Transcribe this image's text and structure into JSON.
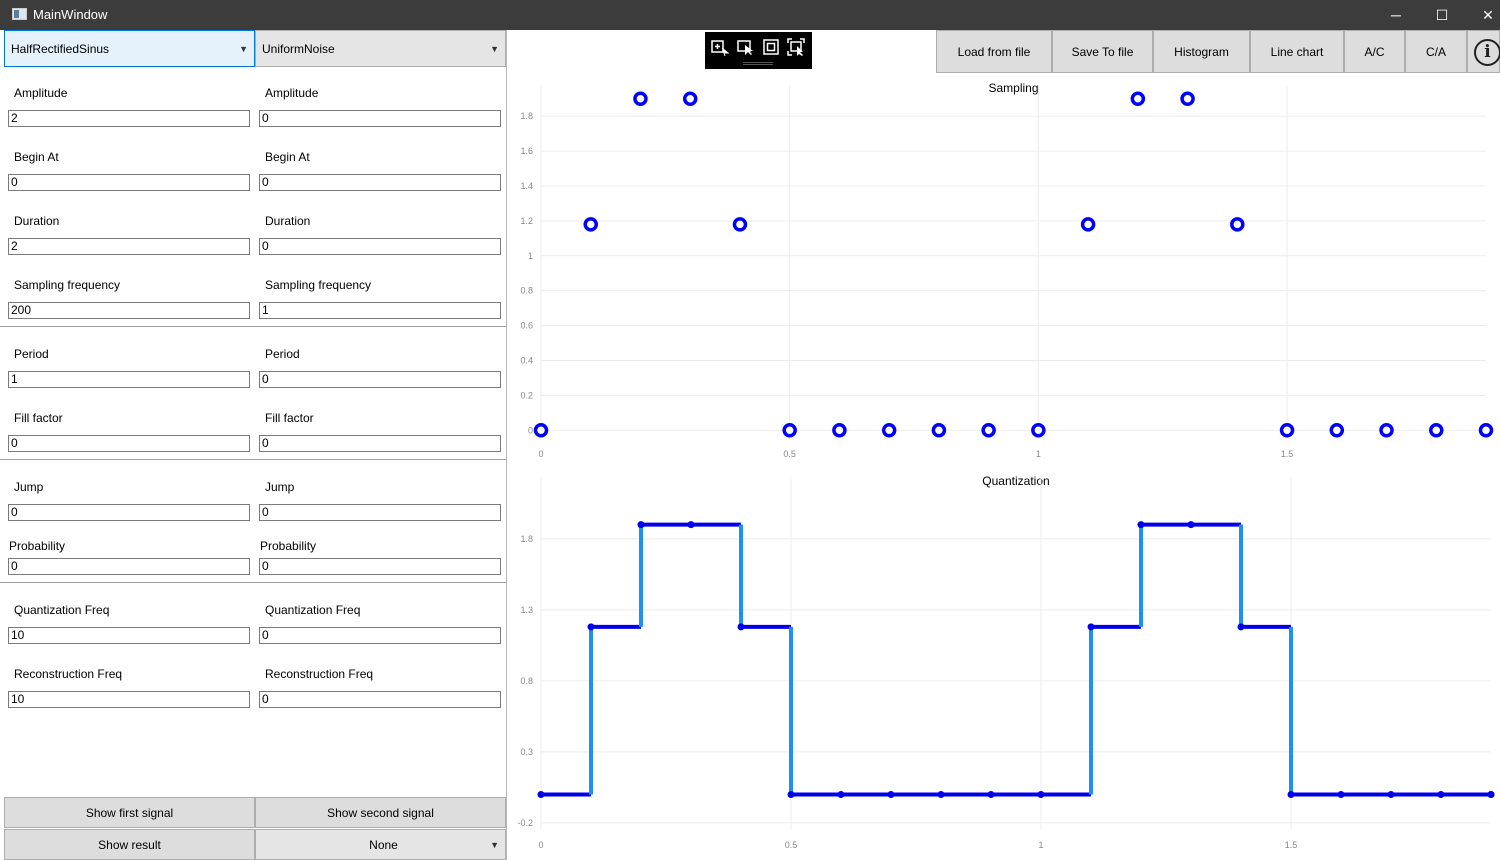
{
  "window": {
    "title": "MainWindow",
    "minimize": "─",
    "maximize": "☐",
    "close": "✕"
  },
  "combos": {
    "first_signal": "HalfRectifiedSinus",
    "second_signal": "UniformNoise",
    "result_op": "None"
  },
  "params": [
    {
      "key": "amplitude",
      "label": "Amplitude",
      "first": "2",
      "second": "0"
    },
    {
      "key": "begin",
      "label": "Begin At",
      "first": "0",
      "second": "0"
    },
    {
      "key": "duration",
      "label": "Duration",
      "first": "2",
      "second": "0"
    },
    {
      "key": "sampling",
      "label": "Sampling frequency",
      "first": "200",
      "second": "1"
    },
    {
      "key": "period",
      "label": "Period",
      "first": "1",
      "second": "0"
    },
    {
      "key": "fill",
      "label": "Fill factor",
      "first": "0",
      "second": "0"
    },
    {
      "key": "jump",
      "label": "Jump",
      "first": "0",
      "second": "0"
    },
    {
      "key": "probability",
      "label": "Probability",
      "first": "0",
      "second": "0"
    },
    {
      "key": "quant",
      "label": "Quantization Freq",
      "first": "10",
      "second": "0"
    },
    {
      "key": "recon",
      "label": "Reconstruction Freq",
      "first": "10",
      "second": "0"
    }
  ],
  "buttons": {
    "show_first": "Show first signal",
    "show_second": "Show second signal",
    "show_result": "Show result"
  },
  "toolbar": {
    "load": "Load from file",
    "save": "Save To file",
    "histogram": "Histogram",
    "line_chart": "Line chart",
    "ac": "A/C",
    "ca": "C/A",
    "info": "i"
  },
  "colors": {
    "sample": "#0000ff",
    "step_vertical": "#1e90ee",
    "step_horizontal": "#0000ee",
    "grid": "#ececec"
  },
  "chart_data": [
    {
      "type": "scatter",
      "title": "Sampling",
      "xlim": [
        0,
        1.9
      ],
      "ylim": [
        -0.05,
        1.95
      ],
      "x_ticks": [
        0,
        0.5,
        1,
        1.5
      ],
      "x_tick_labels": [
        "0",
        "0.5",
        "1",
        "1.5"
      ],
      "y_ticks": [
        0,
        0.2,
        0.4,
        0.6,
        0.8,
        1,
        1.2,
        1.4,
        1.6,
        1.8
      ],
      "y_tick_labels": [
        "0",
        "0.2",
        "0.4",
        "0.6",
        "0.8",
        "1",
        "1.2",
        "1.4",
        "1.6",
        "1.8"
      ],
      "x": [
        0,
        0.1,
        0.2,
        0.3,
        0.4,
        0.5,
        0.6,
        0.7,
        0.8,
        0.9,
        1.0,
        1.1,
        1.2,
        1.3,
        1.4,
        1.5,
        1.6,
        1.7,
        1.8,
        1.9
      ],
      "y": [
        0,
        1.18,
        1.9,
        1.9,
        1.18,
        0,
        0,
        0,
        0,
        0,
        0,
        1.18,
        1.9,
        1.9,
        1.18,
        0,
        0,
        0,
        0,
        0
      ]
    },
    {
      "type": "line",
      "title": "Quantization",
      "xlim": [
        0,
        1.9
      ],
      "ylim": [
        -0.25,
        2.2
      ],
      "x_ticks": [
        0,
        0.5,
        1,
        1.5
      ],
      "x_tick_labels": [
        "0",
        "0.5",
        "1",
        "1.5"
      ],
      "y_ticks": [
        -0.2,
        0.3,
        0.8,
        1.3,
        1.8
      ],
      "y_tick_labels": [
        "-0.2",
        "0.3",
        "0.8",
        "1.3",
        "1.8"
      ],
      "x": [
        0,
        0.1,
        0.2,
        0.3,
        0.4,
        0.5,
        0.6,
        0.7,
        0.8,
        0.9,
        1.0,
        1.1,
        1.2,
        1.3,
        1.4,
        1.5,
        1.6,
        1.7,
        1.8,
        1.9
      ],
      "y": [
        0,
        1.18,
        1.9,
        1.9,
        1.18,
        0,
        0,
        0,
        0,
        0,
        0,
        1.18,
        1.9,
        1.9,
        1.18,
        0,
        0,
        0,
        0,
        0
      ]
    }
  ]
}
